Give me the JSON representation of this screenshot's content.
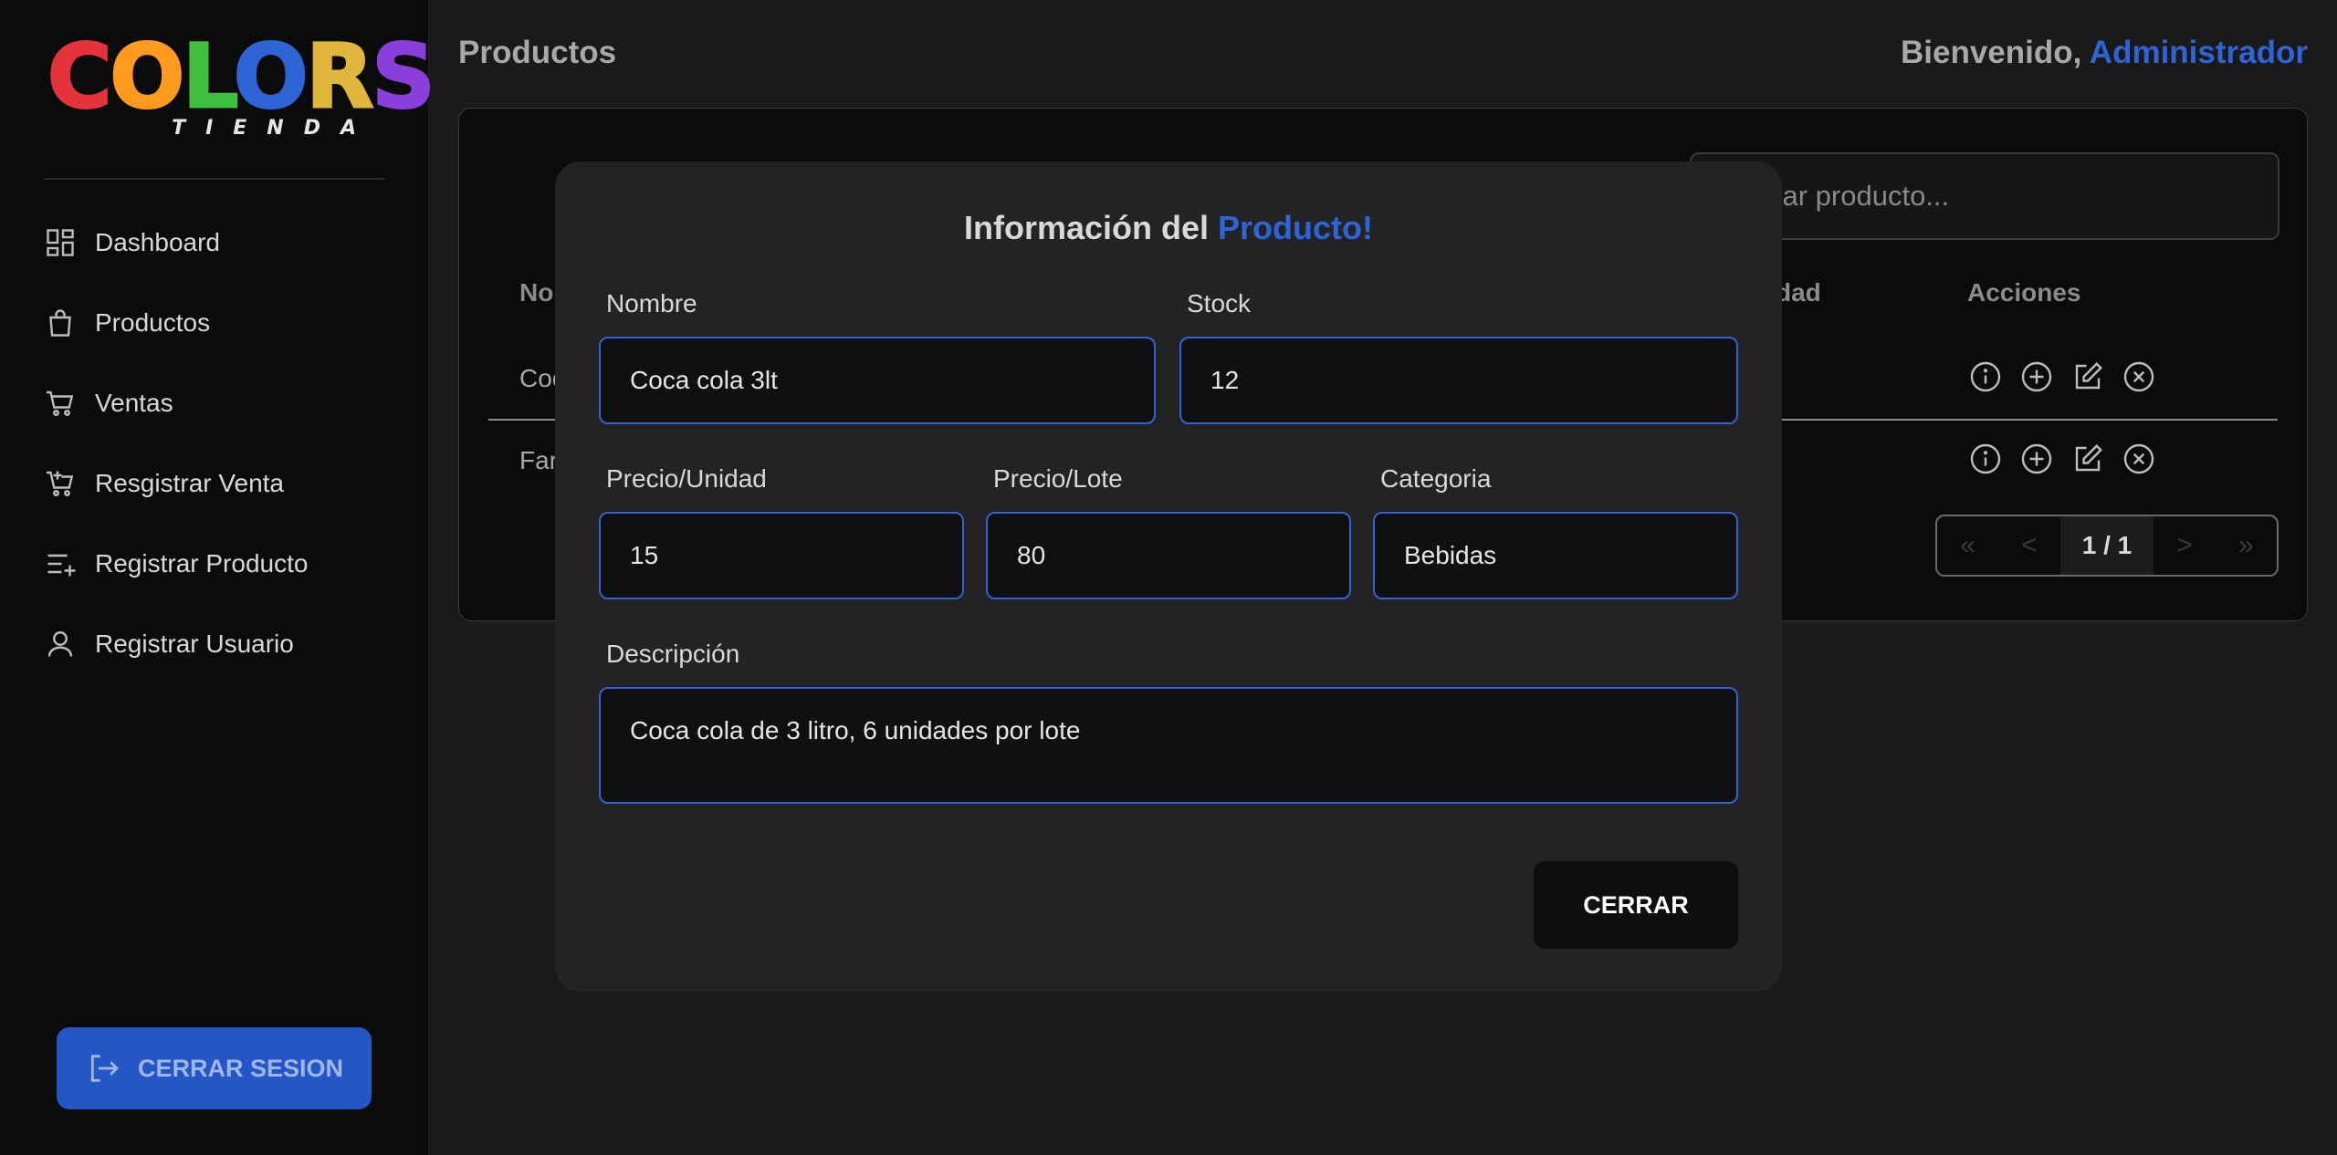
{
  "brand": {
    "logo_word": "COLORS",
    "logo_sub": "TIENDA",
    "letter_colors": [
      "#e5333b",
      "#ff9a1f",
      "#3fbf3f",
      "#2f64d6",
      "#e0b73a",
      "#8a3fdc"
    ]
  },
  "sidebar": {
    "items": [
      {
        "label": "Dashboard",
        "icon": "dashboard-icon"
      },
      {
        "label": "Productos",
        "icon": "bag-icon"
      },
      {
        "label": "Ventas",
        "icon": "cart-icon"
      },
      {
        "label": "Resgistrar Venta",
        "icon": "cart-add-icon"
      },
      {
        "label": "Registrar Producto",
        "icon": "list-add-icon"
      },
      {
        "label": "Registrar Usuario",
        "icon": "user-icon"
      }
    ],
    "logout_label": "CERRAR SESION"
  },
  "header": {
    "title": "Productos",
    "welcome": "Bienvenido, ",
    "user": "Administrador"
  },
  "table": {
    "search_placeholder": "Buscar producto...",
    "search_visible": "car producto...",
    "headers": {
      "name_partial": "No",
      "quantity_partial": "dad",
      "actions": "Acciones"
    },
    "rows": [
      {
        "name_partial": "Coc"
      },
      {
        "name_partial": "Far"
      }
    ],
    "pagination": {
      "first": "«",
      "prev": "<",
      "current": "1 / 1",
      "next": ">",
      "last": "»"
    }
  },
  "modal": {
    "title_prefix": "Información del ",
    "title_accent": "Producto!",
    "fields": {
      "nombre": {
        "label": "Nombre",
        "value": "Coca cola 3lt"
      },
      "stock": {
        "label": "Stock",
        "value": "12"
      },
      "precio_unidad": {
        "label": "Precio/Unidad",
        "value": "15"
      },
      "precio_lote": {
        "label": "Precio/Lote",
        "value": "80"
      },
      "categoria": {
        "label": "Categoria",
        "value": "Bebidas"
      },
      "descripcion": {
        "label": "Descripción",
        "value": "Coca cola de 3 litro, 6 unidades por lote"
      }
    },
    "close_label": "CERRAR"
  },
  "colors": {
    "accent": "#2f64d6",
    "background": "#1a1a1b",
    "sidebar": "#0b0b0c",
    "modal": "#232325"
  }
}
